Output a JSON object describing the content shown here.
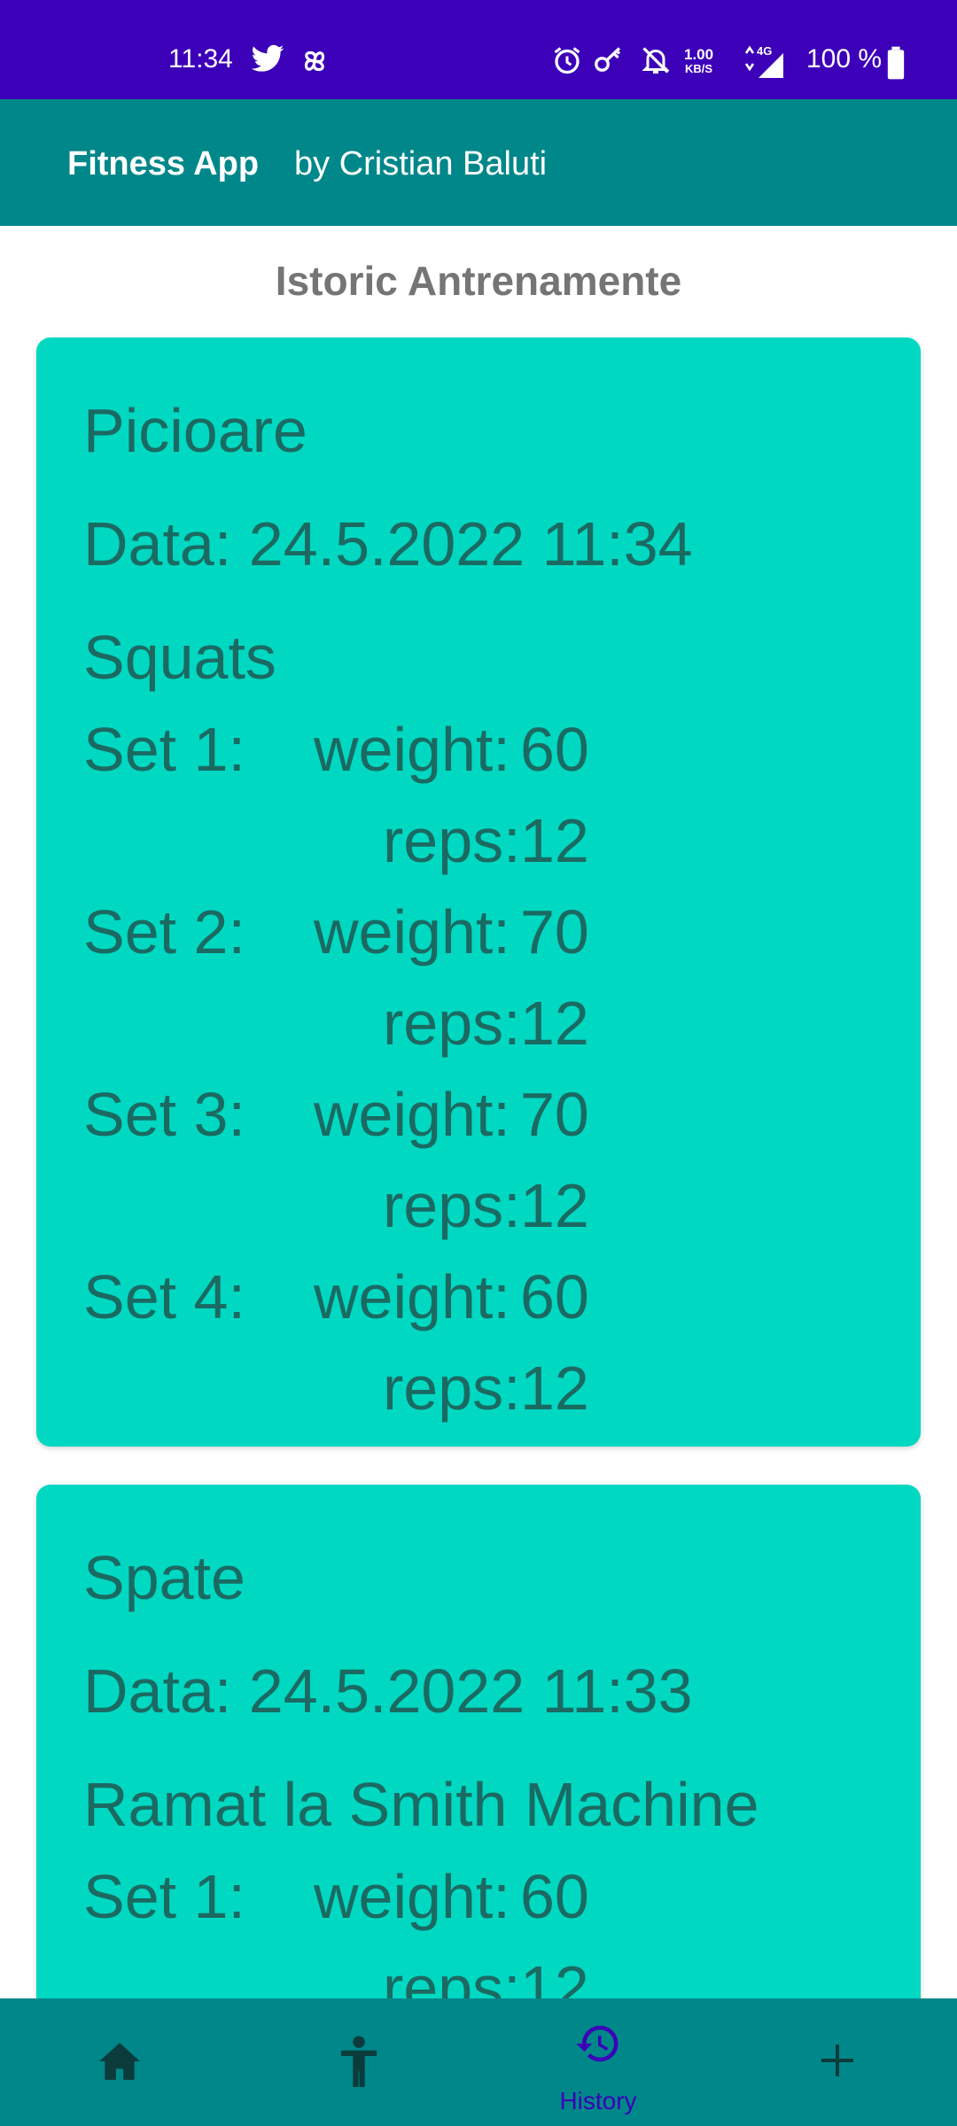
{
  "status_bar": {
    "time": "11:34",
    "net_speed_top": "1.00",
    "net_speed_bottom": "KB/S",
    "network": "4G",
    "battery": "100 %",
    "icons": [
      "twitter-icon",
      "pinwheel-icon",
      "alarm-icon",
      "key-icon",
      "bell-off-icon",
      "data-arrows-icon",
      "signal-icon",
      "battery-icon"
    ],
    "background_color": "#3c00b8"
  },
  "app_bar": {
    "title": "Fitness App",
    "subtitle": "by Cristian Baluti",
    "background_color": "#00878a"
  },
  "page": {
    "heading": "Istoric Antrenamente"
  },
  "workouts": [
    {
      "name": "Picioare",
      "date": "Data: 24.5.2022  11:34",
      "exercise": "Squats",
      "sets": [
        {
          "label": "Set 1:",
          "weight_label": "weight:",
          "weight": "60",
          "reps_label": "reps:",
          "reps": "12"
        },
        {
          "label": "Set 2:",
          "weight_label": "weight:",
          "weight": "70",
          "reps_label": "reps:",
          "reps": "12"
        },
        {
          "label": "Set 3:",
          "weight_label": "weight:",
          "weight": "70",
          "reps_label": "reps:",
          "reps": "12"
        },
        {
          "label": "Set 4:",
          "weight_label": "weight:",
          "weight": "60",
          "reps_label": "reps:",
          "reps": "12"
        }
      ]
    },
    {
      "name": "Spate",
      "date": "Data: 24.5.2022  11:33",
      "exercise": "Ramat la Smith Machine",
      "sets": [
        {
          "label": "Set 1:",
          "weight_label": "weight:",
          "weight": "60",
          "reps_label": "reps:",
          "reps": "12"
        }
      ]
    }
  ],
  "card_color": "#00d8c2",
  "card_text_color": "#1b6a62",
  "bottom_nav": {
    "items": [
      {
        "icon": "home-icon",
        "label": ""
      },
      {
        "icon": "person-icon",
        "label": ""
      },
      {
        "icon": "history-icon",
        "label": "History",
        "active": true
      },
      {
        "icon": "plus-icon",
        "label": ""
      }
    ],
    "active_color": "#3c00b8",
    "inactive_color": "#0b3b3b"
  }
}
